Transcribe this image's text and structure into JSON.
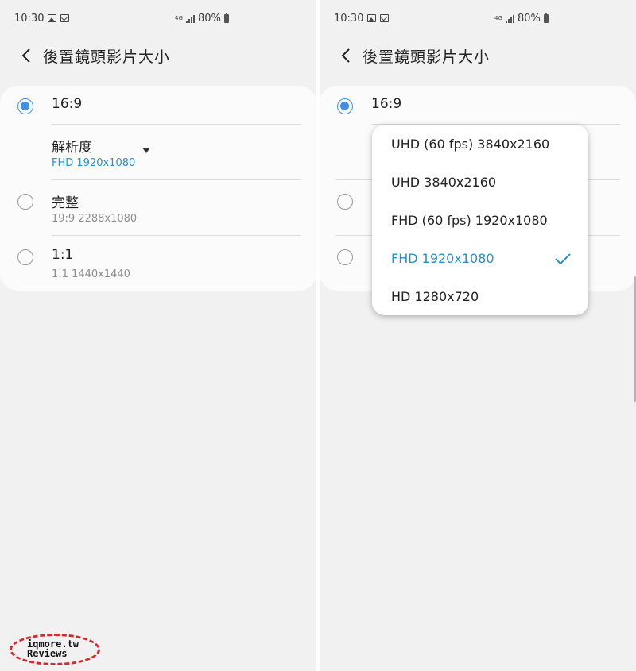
{
  "status": {
    "time": "10:30",
    "network": "4G",
    "battery": "80%"
  },
  "header": {
    "title": "後置鏡頭影片大小"
  },
  "options": [
    {
      "label": "16:9",
      "selected": true
    },
    {
      "label": "完整",
      "sub": "19:9 2288x1080",
      "selected": false
    },
    {
      "label": "1:1",
      "sub": "1:1 1440x1440",
      "selected": false
    }
  ],
  "resolution": {
    "label": "解析度",
    "value": "FHD 1920x1080"
  },
  "dropdown_options": [
    "UHD (60 fps) 3840x2160",
    "UHD 3840x2160",
    "FHD (60 fps) 1920x1080",
    "FHD 1920x1080",
    "HD 1280x720"
  ],
  "dropdown_selected_index": 3,
  "watermark": {
    "line1": "iqmore.tw",
    "line2": "Reviews"
  },
  "colors": {
    "accent": "#3e91e4",
    "selected_text": "#2b8fc9",
    "watermark_ring": "#d9262c"
  }
}
